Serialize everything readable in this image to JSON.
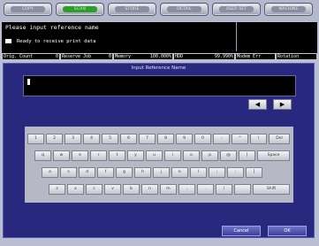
{
  "tabs": [
    {
      "label": "COPY",
      "active": false
    },
    {
      "label": "SCAN",
      "active": true
    },
    {
      "label": "STORE",
      "active": false
    },
    {
      "label": "DETAIL",
      "active": false
    },
    {
      "label": "USER SET",
      "active": false
    },
    {
      "label": "MACHINE",
      "active": false
    }
  ],
  "message": {
    "line1": "Please input reference name",
    "line2": "Ready to receive print data"
  },
  "status": {
    "orig_count_label": "Orig. Count",
    "orig_count_value": "0",
    "reserve_job_label": "Reserve Job",
    "reserve_job_value": "0",
    "memory_label": "Memory",
    "memory_value": "100.000%",
    "hdd_label": "HDD",
    "hdd_value": "99.990%",
    "modem_label": "Modem Err",
    "rotation_label": "Rotation"
  },
  "dialog": {
    "title": "Input Reference Name",
    "input_value": "",
    "left_arrow": "◀",
    "right_arrow": "▶",
    "cancel_label": "Cancel",
    "ok_label": "OK"
  },
  "keyboard": {
    "row1": [
      "1",
      "2",
      "3",
      "4",
      "5",
      "6",
      "7",
      "8",
      "9",
      "0",
      "-",
      "^",
      "\\",
      "Del"
    ],
    "row2": [
      "q",
      "w",
      "e",
      "r",
      "t",
      "y",
      "u",
      "i",
      "o",
      "p",
      "@",
      "[",
      "Space"
    ],
    "row3": [
      "a",
      "s",
      "d",
      "f",
      "g",
      "h",
      "j",
      "k",
      "l",
      ";",
      ":",
      "]"
    ],
    "row4": [
      "z",
      "x",
      "c",
      "v",
      "b",
      "n",
      "m",
      ",",
      ".",
      "/",
      "",
      "Shift"
    ]
  },
  "colors": {
    "dialog_bg": "#28297e",
    "active_tab": "#2c9e2c",
    "button_blue": "#4a4eb0"
  }
}
